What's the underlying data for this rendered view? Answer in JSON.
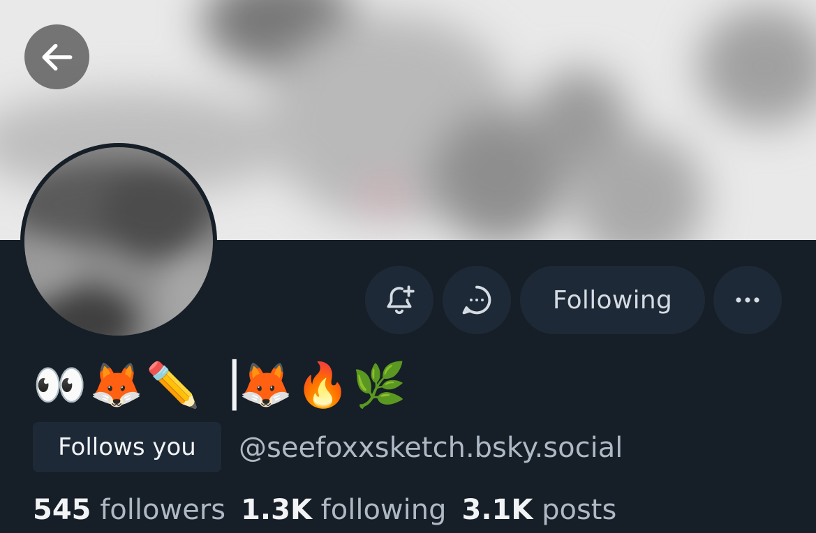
{
  "header": {
    "back_icon": "arrow-left-icon"
  },
  "actions": {
    "subscribe_icon": "bell-plus-icon",
    "message_icon": "chat-bubble-icon",
    "following_label": "Following",
    "more_icon": "ellipsis-icon"
  },
  "profile": {
    "display_name": "👀🦊✏️▕🦊🔥🌿",
    "follows_you_label": "Follows you",
    "handle": "@seefoxxsketch.bsky.social"
  },
  "stats": {
    "followers_count": "545",
    "followers_label": "followers",
    "following_count": "1.3K",
    "following_label": "following",
    "posts_count": "3.1K",
    "posts_label": "posts"
  },
  "colors": {
    "background": "#161e27",
    "button_bg": "#1e2938",
    "text_primary": "#f1f3f5",
    "text_secondary": "#aeb9c5"
  }
}
